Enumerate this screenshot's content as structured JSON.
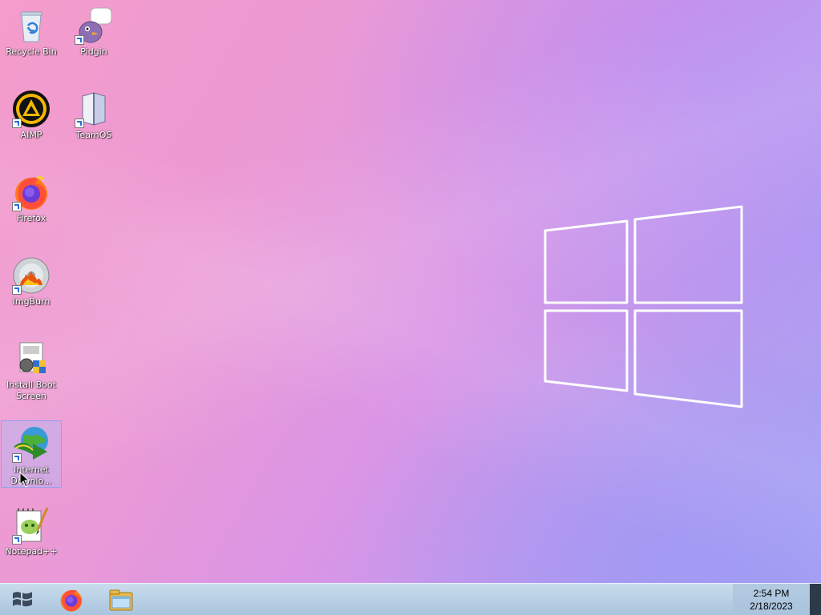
{
  "desktop": {
    "icons": [
      {
        "label": "Recycle Bin",
        "icon": "recycle-bin-icon",
        "shortcut": false
      },
      {
        "label": "Pidgin",
        "icon": "pidgin-icon",
        "shortcut": true
      },
      {
        "label": "AIMP",
        "icon": "aimp-icon",
        "shortcut": true
      },
      {
        "label": "TeamOS",
        "icon": "teamos-icon",
        "shortcut": true
      },
      {
        "label": "Firefox",
        "icon": "firefox-icon",
        "shortcut": true
      },
      {
        "label": "ImgBurn",
        "icon": "imgburn-icon",
        "shortcut": true
      },
      {
        "label": "Install Boot Screen",
        "icon": "install-boot-screen-icon",
        "shortcut": false
      },
      {
        "label": "Internet Downlo...",
        "icon": "internet-download-manager-icon",
        "shortcut": true,
        "selected": true
      },
      {
        "label": "Notepad++",
        "icon": "notepad-plus-plus-icon",
        "shortcut": true
      }
    ]
  },
  "taskbar": {
    "start_icon": "windows-start-icon",
    "pinned": [
      {
        "name": "Firefox",
        "icon": "firefox-icon"
      },
      {
        "name": "File Explorer",
        "icon": "file-explorer-icon"
      }
    ],
    "clock": {
      "time": "2:54 PM",
      "date": "2/18/2023"
    }
  },
  "colors": {
    "wallpaper_pink": "#f49ccb",
    "wallpaper_purple": "#b79bf0",
    "taskbar": "#bcd3e8",
    "selection": "#a0beff"
  }
}
